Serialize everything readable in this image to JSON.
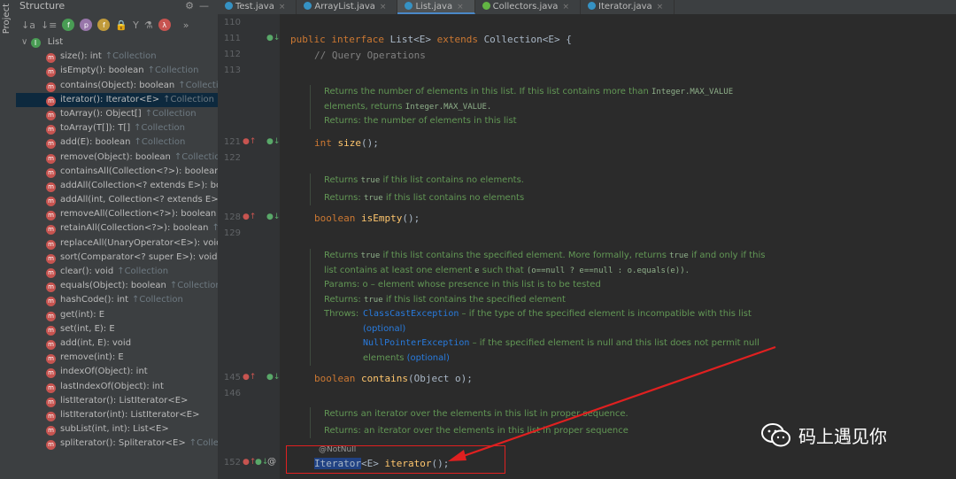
{
  "side_strip": {
    "label": "Project"
  },
  "structure": {
    "title": "Structure",
    "root": "List",
    "items": [
      {
        "name": "size(): int",
        "src": "↑Collection",
        "kind": "m"
      },
      {
        "name": "isEmpty(): boolean",
        "src": "↑Collection",
        "kind": "m"
      },
      {
        "name": "contains(Object): boolean",
        "src": "↑Collection",
        "kind": "m"
      },
      {
        "name": "iterator(): Iterator<E>",
        "src": "↑Collection",
        "kind": "m",
        "selected": true
      },
      {
        "name": "toArray(): Object[]",
        "src": "↑Collection",
        "kind": "m"
      },
      {
        "name": "toArray(T[]): T[]",
        "src": "↑Collection",
        "kind": "m"
      },
      {
        "name": "add(E): boolean",
        "src": "↑Collection",
        "kind": "m"
      },
      {
        "name": "remove(Object): boolean",
        "src": "↑Collection",
        "kind": "m"
      },
      {
        "name": "containsAll(Collection<?>): boolean",
        "src": "",
        "kind": "m"
      },
      {
        "name": "addAll(Collection<? extends E>): bo",
        "src": "",
        "kind": "m"
      },
      {
        "name": "addAll(int, Collection<? extends E>",
        "src": "",
        "kind": "m"
      },
      {
        "name": "removeAll(Collection<?>): boolean",
        "src": "",
        "kind": "m"
      },
      {
        "name": "retainAll(Collection<?>): boolean",
        "src": "↑",
        "kind": "m"
      },
      {
        "name": "replaceAll(UnaryOperator<E>): void",
        "src": "",
        "kind": "m"
      },
      {
        "name": "sort(Comparator<? super E>): void",
        "src": "",
        "kind": "m"
      },
      {
        "name": "clear(): void",
        "src": "↑Collection",
        "kind": "m"
      },
      {
        "name": "equals(Object): boolean",
        "src": "↑Collection",
        "kind": "m"
      },
      {
        "name": "hashCode(): int",
        "src": "↑Collection",
        "kind": "m"
      },
      {
        "name": "get(int): E",
        "src": "",
        "kind": "m"
      },
      {
        "name": "set(int, E): E",
        "src": "",
        "kind": "m"
      },
      {
        "name": "add(int, E): void",
        "src": "",
        "kind": "m"
      },
      {
        "name": "remove(int): E",
        "src": "",
        "kind": "m"
      },
      {
        "name": "indexOf(Object): int",
        "src": "",
        "kind": "m"
      },
      {
        "name": "lastIndexOf(Object): int",
        "src": "",
        "kind": "m"
      },
      {
        "name": "listIterator(): ListIterator<E>",
        "src": "",
        "kind": "m"
      },
      {
        "name": "listIterator(int): ListIterator<E>",
        "src": "",
        "kind": "m"
      },
      {
        "name": "subList(int, int): List<E>",
        "src": "",
        "kind": "m"
      },
      {
        "name": "spliterator(): Spliterator<E>",
        "src": "↑Colle",
        "kind": "m"
      }
    ]
  },
  "tabs": [
    {
      "label": "Test.java",
      "active": false
    },
    {
      "label": "ArrayList.java",
      "active": false
    },
    {
      "label": "List.java",
      "active": true
    },
    {
      "label": "Collectors.java",
      "active": false
    },
    {
      "label": "Iterator.java",
      "active": false
    }
  ],
  "line_numbers": {
    "l110": "110",
    "l111": "111",
    "l112": "112",
    "l113": "113",
    "l121": "121",
    "l122": "122",
    "l128": "128",
    "l129": "129",
    "l145": "145",
    "l146": "146",
    "l152": "152"
  },
  "code": {
    "decl_kw1": "public interface ",
    "decl_name": "List<E> ",
    "decl_kw2": "extends ",
    "decl_rest": "Collection<E> {",
    "comment_query": "// Query Operations",
    "size_type": "int ",
    "size_fn": "size",
    "size_tail": "();",
    "isempty_type": "boolean ",
    "isempty_fn": "isEmpty",
    "isempty_tail": "();",
    "contains_type": "boolean ",
    "contains_fn": "contains",
    "contains_tail": "(Object o);",
    "notnull": "@NotNull",
    "iter_type": "Iterator",
    "iter_generic": "<E> ",
    "iter_fn": "iterator",
    "iter_tail": "();"
  },
  "docs": {
    "size_1": "Returns the number of elements in this list. If this list contains more than ",
    "size_1_code": "Integer.MAX_VALUE",
    "size_2": "elements, returns ",
    "size_2_code": "Integer.MAX_VALUE.",
    "size_3": "Returns: the number of elements in this list",
    "empty_1a": "Returns ",
    "empty_1code": "true",
    "empty_1b": " if this list contains no elements.",
    "empty_2a": "Returns: ",
    "empty_2code": "true",
    "empty_2b": " if this list contains no elements",
    "contains_1a": "Returns ",
    "contains_1code": "true",
    "contains_1b": " if this list contains the specified element. More formally, returns ",
    "contains_1code2": "true",
    "contains_1c": " if and only if this",
    "contains_2a": "list contains at least one element ",
    "contains_2code": "e",
    "contains_2b": " such that ",
    "contains_2code2": "(o==null  ?  e==null  :  o.equals(e)).",
    "contains_3": "Params: o – element whose presence in this list is to be tested",
    "contains_4a": "Returns: ",
    "contains_4code": "true",
    "contains_4b": " if this list contains the specified element",
    "throws_label": "Throws:",
    "throws_1link": "ClassCastException",
    "throws_1text": " – if the type of the specified element is incompatible with this list",
    "throws_1opt": "(optional)",
    "throws_2link": "NullPointerException",
    "throws_2text": " – if the specified element is null and this list does not permit null",
    "throws_2b": "elements ",
    "throws_2opt": "(optional)",
    "iter_1": "Returns an iterator over the elements in this list in proper sequence.",
    "iter_2": "Returns: an iterator over the elements in this list in proper sequence"
  },
  "watermark": {
    "text": "码上遇见你"
  },
  "colors": {
    "keyword": "#cc7832",
    "function": "#ffc66d",
    "doc": "#629755",
    "link": "#287bde",
    "annotation_box": "#e02020"
  }
}
